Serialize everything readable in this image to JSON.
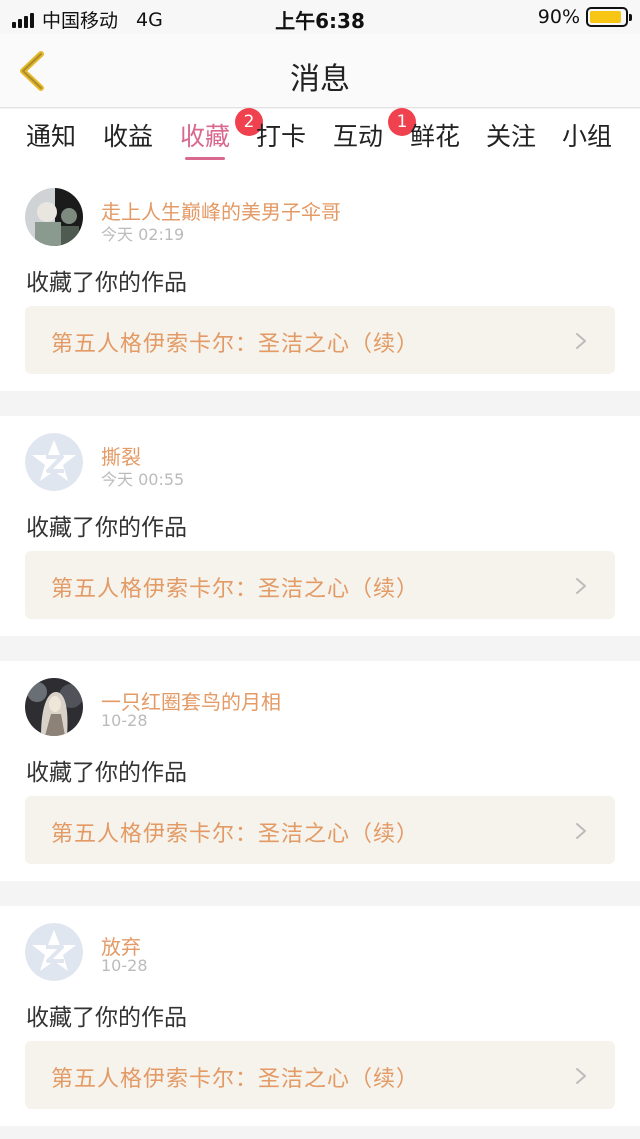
{
  "status": {
    "carrier": "中国移动",
    "network": "4G",
    "time": "上午6:38",
    "battery_text": "90%",
    "battery_level": 0.9
  },
  "header": {
    "title": "消息",
    "back_icon": "chevron-left-icon"
  },
  "tabs": [
    {
      "label": "通知"
    },
    {
      "label": "收益"
    },
    {
      "label": "收藏",
      "active": true,
      "badge": "2"
    },
    {
      "label": "打卡"
    },
    {
      "label": "互动",
      "badge": "1"
    },
    {
      "label": "鲜花"
    },
    {
      "label": "关注"
    },
    {
      "label": "小组"
    }
  ],
  "feed": [
    {
      "username": "走上人生巅峰的美男子伞哥",
      "time": "今天 02:19",
      "action": "收藏了你的作品",
      "work_title": "第五人格伊索卡尔：圣洁之心（续）",
      "avatar": "photo"
    },
    {
      "username": "撕裂",
      "time": "今天 00:55",
      "action": "收藏了你的作品",
      "work_title": "第五人格伊索卡尔：圣洁之心（续）",
      "avatar": "default"
    },
    {
      "username": "一只红圈套鸟的月相",
      "time": "10-28",
      "action": "收藏了你的作品",
      "work_title": "第五人格伊索卡尔：圣洁之心（续）",
      "avatar": "photo"
    },
    {
      "username": "放弃",
      "time": "10-28",
      "action": "收藏了你的作品",
      "work_title": "第五人格伊索卡尔：圣洁之心（续）",
      "avatar": "default"
    }
  ],
  "colors": {
    "accent": "#d9688f",
    "username": "#e39a65",
    "badge": "#f0414e",
    "back_arrow": "#e5b92a"
  }
}
